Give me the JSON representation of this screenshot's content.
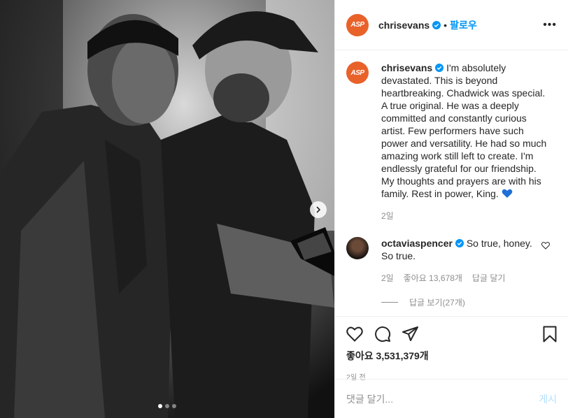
{
  "header": {
    "avatar_text": "ASP",
    "username": "chrisevans",
    "separator": "•",
    "follow_label": "팔로우",
    "more_label": "•••"
  },
  "caption": {
    "username": "chrisevans",
    "text": "I'm absolutely devastated. This is beyond heartbreaking. Chadwick was special. A true original. He was a deeply committed and constantly curious artist. Few performers have such power and versatility. He had so much amazing work still left to create. I'm endlessly grateful for our friendship. My thoughts and prayers are with his family. Rest in power, King.",
    "time": "2일"
  },
  "comment": {
    "username": "octaviaspencer",
    "text": "So true, honey. So true.",
    "time": "2일",
    "likes": "좋아요 13,678개",
    "reply_label": "답글 달기",
    "view_replies": "답글 보기(27개)"
  },
  "actions": {
    "likes": "좋아요 3,531,379개",
    "time_ago": "2일 전"
  },
  "add_comment": {
    "placeholder": "댓글 달기...",
    "post_label": "게시"
  },
  "carousel": {
    "slide_count": 3,
    "active_index": 0
  },
  "colors": {
    "accent": "#0095f6",
    "brand_avatar": "#e8622a",
    "muted": "#8e8e8e"
  }
}
